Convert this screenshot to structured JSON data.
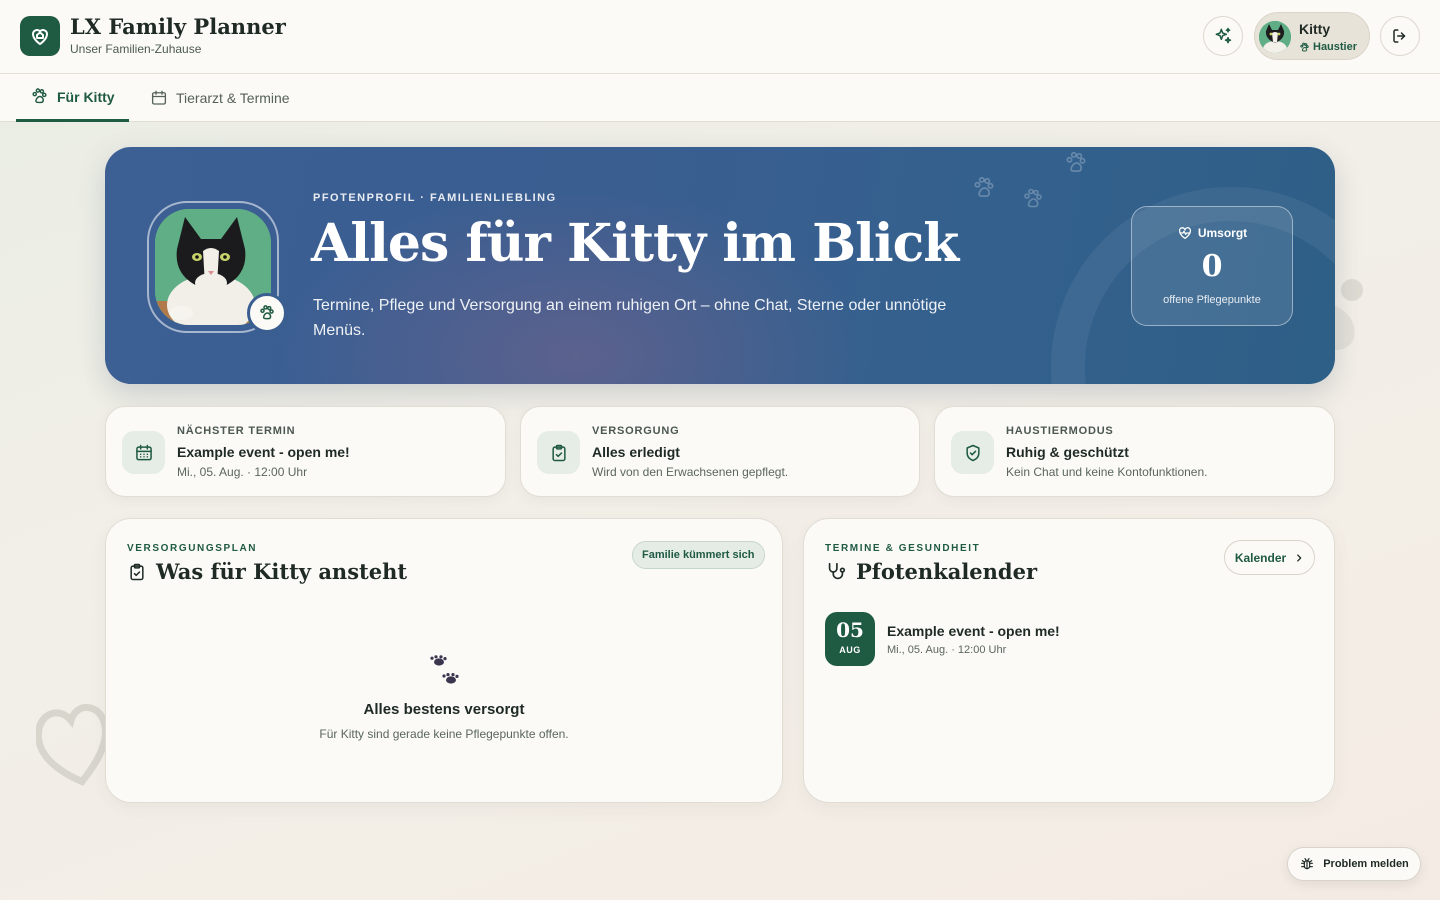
{
  "app": {
    "title": "LX Family Planner",
    "subtitle": "Unser Familien-Zuhause"
  },
  "user": {
    "name": "Kitty",
    "role": "Haustier"
  },
  "tabs": [
    {
      "label": "Für Kitty",
      "icon": "paw-icon",
      "active": true
    },
    {
      "label": "Tierarzt & Termine",
      "icon": "calendar-icon",
      "active": false
    }
  ],
  "hero": {
    "eyebrow": "PFOTENPROFIL · FAMILIENLIEBLING",
    "title": "Alles für Kitty im Blick",
    "description": "Termine, Pflege und Versorgung an einem ruhigen Ort – ohne Chat, Sterne oder unnötige Menüs.",
    "stat": {
      "label": "Umsorgt",
      "value": "0",
      "caption": "offene Pflegepunkte"
    }
  },
  "info_cards": [
    {
      "eyebrow": "NÄCHSTER TERMIN",
      "title": "Example event - open me!",
      "subtitle": "Mi., 05. Aug. · 12:00 Uhr",
      "icon": "calendar-icon"
    },
    {
      "eyebrow": "VERSORGUNG",
      "title": "Alles erledigt",
      "subtitle": "Wird von den Erwachsenen gepflegt.",
      "icon": "clipboard-check-icon"
    },
    {
      "eyebrow": "HAUSTIERMODUS",
      "title": "Ruhig & geschützt",
      "subtitle": "Kein Chat und keine Kontofunktionen.",
      "icon": "shield-check-icon"
    }
  ],
  "care_panel": {
    "eyebrow": "VERSORGUNGSPLAN",
    "title": "Was für Kitty ansteht",
    "pill": "Familie kümmert sich",
    "empty_title": "Alles bestens versorgt",
    "empty_subtitle": "Für Kitty sind gerade keine Pflegepunkte offen."
  },
  "calendar_panel": {
    "eyebrow": "TERMINE & GESUNDHEIT",
    "title": "Pfotenkalender",
    "button": "Kalender",
    "events": [
      {
        "day": "05",
        "month": "AUG",
        "title": "Example event - open me!",
        "subtitle": "Mi., 05. Aug. · 12:00 Uhr"
      }
    ]
  },
  "problem_button": "Problem melden",
  "colors": {
    "brand": "#1f5a43",
    "hero_blue": "#3a5e90",
    "card_bg": "#fbfaf6"
  }
}
